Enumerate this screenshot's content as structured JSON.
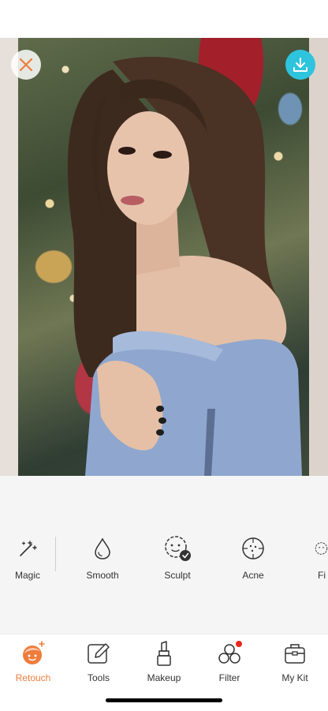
{
  "photo": {
    "description_icon": "portrait-photo"
  },
  "controls": {
    "close_icon": "close-icon",
    "download_icon": "download-icon"
  },
  "tools": [
    {
      "label": "Magic",
      "icon": "magic-wand-icon"
    },
    {
      "label": "Smooth",
      "icon": "droplet-icon"
    },
    {
      "label": "Sculpt",
      "icon": "face-sculpt-icon"
    },
    {
      "label": "Acne",
      "icon": "acne-icon"
    },
    {
      "label": "Fi",
      "icon": "face-icon"
    }
  ],
  "tabs": [
    {
      "label": "Retouch",
      "icon": "retouch-face-icon",
      "active": true
    },
    {
      "label": "Tools",
      "icon": "pencil-icon"
    },
    {
      "label": "Makeup",
      "icon": "lipstick-icon"
    },
    {
      "label": "Filter",
      "icon": "filter-circles-icon",
      "badge": true
    },
    {
      "label": "My Kit",
      "icon": "kit-bag-icon"
    }
  ],
  "colors": {
    "accent": "#ef7c3b",
    "download": "#2ec4dd",
    "badge": "#e8281e"
  }
}
